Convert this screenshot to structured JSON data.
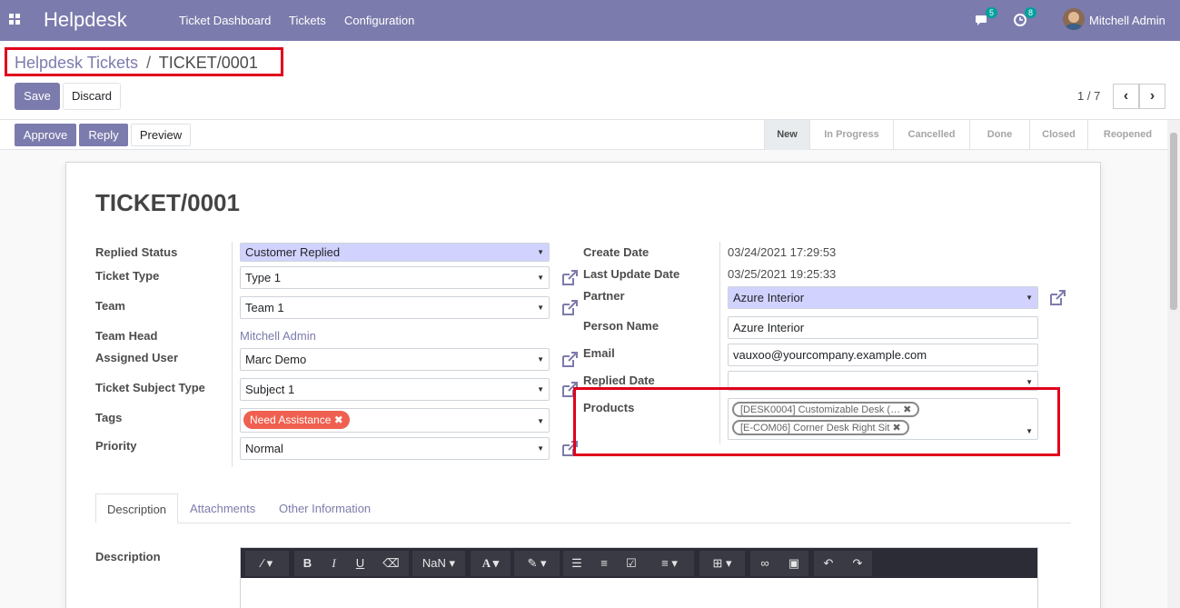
{
  "navbar": {
    "brand": "Helpdesk",
    "menu": [
      "Ticket Dashboard",
      "Tickets",
      "Configuration"
    ],
    "messages_count": "5",
    "activities_count": "8",
    "user_name": "Mitchell Admin"
  },
  "breadcrumb": {
    "parent": "Helpdesk Tickets",
    "separator": "/",
    "current": "TICKET/0001"
  },
  "buttons": {
    "save": "Save",
    "discard": "Discard",
    "approve": "Approve",
    "reply": "Reply",
    "preview": "Preview"
  },
  "pager": {
    "value": "1 / 7"
  },
  "stages": [
    "New",
    "In Progress",
    "Cancelled",
    "Done",
    "Closed",
    "Reopened"
  ],
  "active_stage": "New",
  "ticket": {
    "title": "TICKET/0001",
    "left": {
      "replied_status_label": "Replied Status",
      "replied_status": "Customer Replied",
      "ticket_type_label": "Ticket Type",
      "ticket_type": "Type 1",
      "team_label": "Team",
      "team": "Team 1",
      "team_head_label": "Team Head",
      "team_head": "Mitchell Admin",
      "assigned_user_label": "Assigned User",
      "assigned_user": "Marc Demo",
      "subject_type_label": "Ticket Subject Type",
      "subject_type": "Subject 1",
      "tags_label": "Tags",
      "tags": [
        "Need Assistance"
      ],
      "priority_label": "Priority",
      "priority": "Normal"
    },
    "right": {
      "create_date_label": "Create Date",
      "create_date": "03/24/2021 17:29:53",
      "last_update_label": "Last Update Date",
      "last_update": "03/25/2021 19:25:33",
      "partner_label": "Partner",
      "partner": "Azure Interior",
      "person_name_label": "Person Name",
      "person_name": "Azure Interior",
      "email_label": "Email",
      "email": "vauxoo@yourcompany.example.com",
      "replied_date_label": "Replied Date",
      "replied_date": "",
      "products_label": "Products",
      "products": [
        "[DESK0004] Customizable Desk (…",
        "[E-COM06] Corner Desk Right Sit"
      ]
    }
  },
  "tabs": [
    "Description",
    "Attachments",
    "Other Information"
  ],
  "description_label": "Description",
  "editor": {
    "font_size": "NaN"
  },
  "colors": {
    "brand": "#7c7bad",
    "highlight": "#e0001b",
    "tag": "#f06050"
  }
}
